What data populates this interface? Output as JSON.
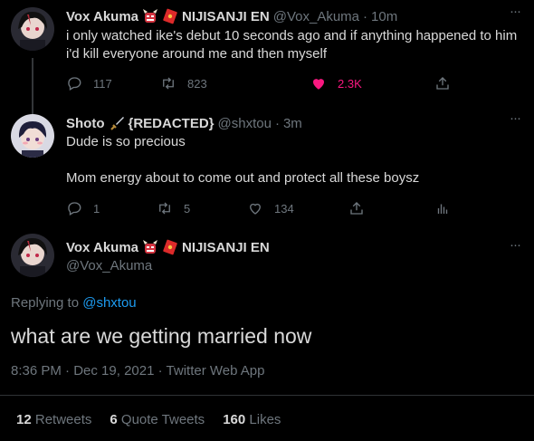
{
  "colors": {
    "accent": "#1d9bf0",
    "like": "#f91880",
    "muted": "#6e767d",
    "text": "#d9d9d9",
    "background": "#000000"
  },
  "tweet1": {
    "name": "Vox Akuma",
    "badge_org": "NIJISANJI EN",
    "handle": "@Vox_Akuma",
    "separator": "·",
    "time": "10m",
    "text": "i only watched ike's debut 10 seconds ago and if anything happened to him i'd kill everyone around me and then myself",
    "replies": "117",
    "retweets": "823",
    "likes": "2.3K",
    "icons": [
      "oni-emoji-icon",
      "red-envelope-emoji-icon",
      "reply-icon",
      "retweet-icon",
      "heart-filled-icon",
      "share-icon"
    ]
  },
  "tweet2": {
    "name": "Shoto",
    "redacted": "{REDACTED}",
    "handle": "@shxtou",
    "separator": "·",
    "time": "3m",
    "line1": "Dude is so precious",
    "line2": "Mom energy about to come out and protect all these boysz",
    "replies": "1",
    "retweets": "5",
    "likes": "134",
    "icons": [
      "dagger-emoji-icon",
      "reply-icon",
      "retweet-icon",
      "heart-icon",
      "share-icon",
      "analytics-icon"
    ]
  },
  "main": {
    "name": "Vox Akuma",
    "badge_org": "NIJISANJI EN",
    "handle": "@Vox_Akuma",
    "replying_prefix": "Replying to",
    "replying_to": "@shxtou",
    "text": "what are we getting married now",
    "time": "8:36 PM",
    "date": "Dec 19, 2021",
    "source": "Twitter Web App",
    "sep": "·",
    "retweets_count": "12",
    "retweets_label": "Retweets",
    "quotes_count": "6",
    "quotes_label": "Quote Tweets",
    "likes_count": "160",
    "likes_label": "Likes"
  }
}
